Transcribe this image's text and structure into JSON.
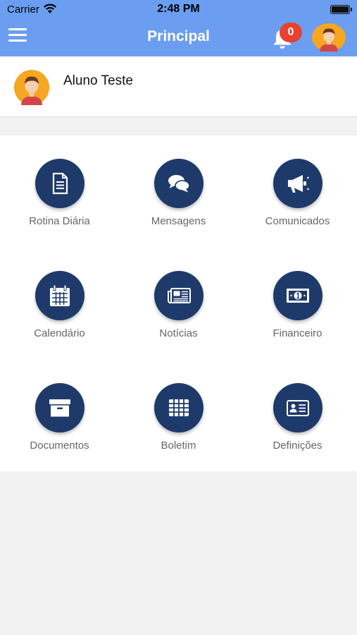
{
  "status_bar": {
    "carrier": "Carrier",
    "time": "2:48 PM"
  },
  "header": {
    "title": "Principal",
    "notification_count": "0",
    "accent": "#6b9ef0",
    "badge_color": "#e8412f"
  },
  "profile": {
    "name": "Aluno Teste"
  },
  "menu": {
    "tile_color": "#1e3a6b",
    "items": [
      {
        "label": "Rotina Diária",
        "icon": "document-icon"
      },
      {
        "label": "Mensagens",
        "icon": "chat-icon"
      },
      {
        "label": "Comunicados",
        "icon": "megaphone-icon"
      },
      {
        "label": "Calendário",
        "icon": "calendar-icon"
      },
      {
        "label": "Notícias",
        "icon": "newspaper-icon"
      },
      {
        "label": "Financeiro",
        "icon": "money-icon"
      },
      {
        "label": "Documentos",
        "icon": "archive-box-icon"
      },
      {
        "label": "Boletim",
        "icon": "table-icon"
      },
      {
        "label": "Definições",
        "icon": "id-card-icon"
      }
    ]
  }
}
